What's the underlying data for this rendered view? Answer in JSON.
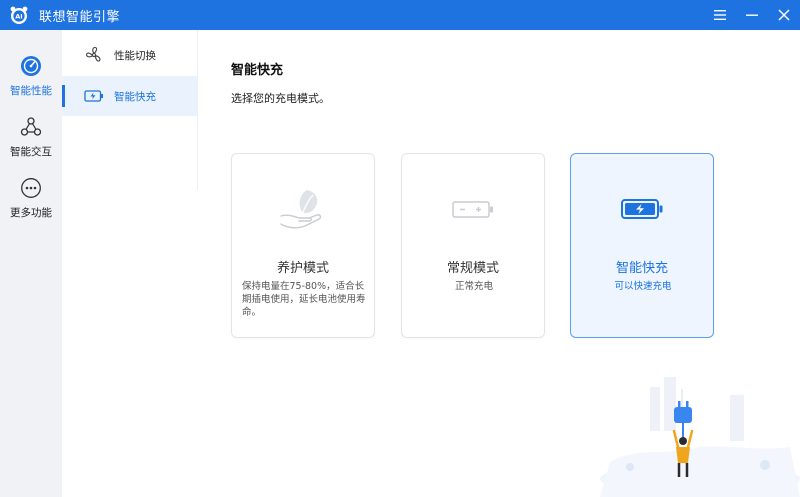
{
  "app": {
    "title": "联想智能引擎",
    "accent": "#1e73e0"
  },
  "leftnav": {
    "items": [
      {
        "label": "智能性能",
        "icon": "speedometer-icon",
        "active": true
      },
      {
        "label": "智能交互",
        "icon": "interaction-icon",
        "active": false
      },
      {
        "label": "更多功能",
        "icon": "more-dots-icon",
        "active": false
      }
    ]
  },
  "subnav": {
    "items": [
      {
        "label": "性能切换",
        "icon": "fan-icon",
        "active": false
      },
      {
        "label": "智能快充",
        "icon": "battery-charge-icon",
        "active": true
      }
    ]
  },
  "main": {
    "title": "智能快充",
    "subtitle": "选择您的充电模式。",
    "modes": [
      {
        "name": "养护模式",
        "desc": "保持电量在75-80%，适合长期插电使用，延长电池使用寿命。",
        "icon": "leaf-hand-icon",
        "selected": false
      },
      {
        "name": "常规模式",
        "desc": "正常充电",
        "icon": "battery-normal-icon",
        "selected": false
      },
      {
        "name": "智能快充",
        "desc": "可以快速充电",
        "icon": "battery-fast-icon",
        "selected": true
      }
    ]
  }
}
